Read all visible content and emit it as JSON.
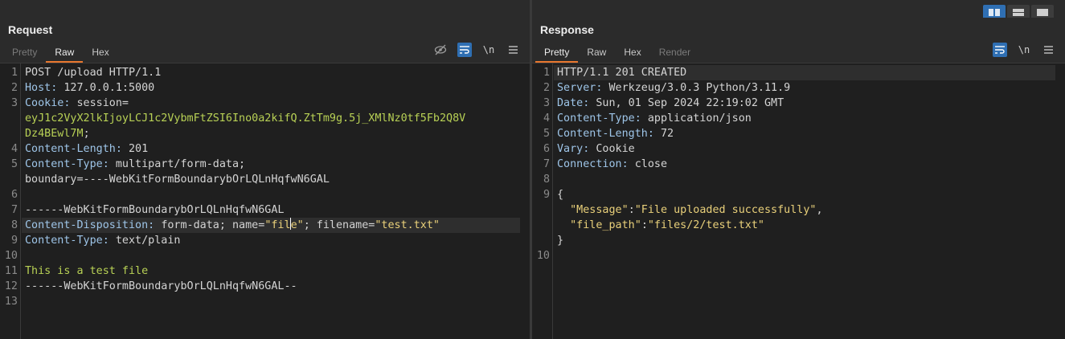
{
  "request": {
    "title": "Request",
    "tabs": [
      "Pretty",
      "Raw",
      "Hex"
    ],
    "active_tab": "Raw",
    "newline_label": "\\n",
    "lines": [
      {
        "n": "1",
        "parts": [
          [
            "w",
            "POST /upload HTTP/1.1"
          ]
        ]
      },
      {
        "n": "2",
        "parts": [
          [
            "k",
            "Host: "
          ],
          [
            "v",
            "127.0.0.1:5000"
          ]
        ]
      },
      {
        "n": "3",
        "parts": [
          [
            "k",
            "Cookie: "
          ],
          [
            "v",
            "session="
          ]
        ]
      },
      {
        "n": "",
        "parts": [
          [
            "g",
            "eyJ1c2VyX2lkIjoyLCJ1c2VybmFtZSI6Ino0a2kifQ.ZtTm9g.5j_XMlNz0tf5Fb2Q8V"
          ]
        ]
      },
      {
        "n": "",
        "parts": [
          [
            "g",
            "Dz4BEwl7M"
          ],
          [
            "v",
            ";"
          ]
        ]
      },
      {
        "n": "4",
        "parts": [
          [
            "k",
            "Content-Length: "
          ],
          [
            "v",
            "201"
          ]
        ]
      },
      {
        "n": "5",
        "parts": [
          [
            "k",
            "Content-Type: "
          ],
          [
            "v",
            "multipart/form-data;"
          ]
        ]
      },
      {
        "n": "",
        "parts": [
          [
            "v",
            "boundary=----WebKitFormBoundarybOrLQLnHqfwN6GAL"
          ]
        ]
      },
      {
        "n": "6",
        "parts": []
      },
      {
        "n": "7",
        "parts": [
          [
            "w",
            "------WebKitFormBoundarybOrLQLnHqfwN6GAL"
          ]
        ]
      },
      {
        "n": "8",
        "parts": [
          [
            "k",
            "Content-Disposition: "
          ],
          [
            "v",
            "form-data; name="
          ],
          [
            "y",
            "\"fil"
          ],
          [
            "cursor",
            ""
          ],
          [
            "y",
            "e\""
          ],
          [
            "v",
            "; filename="
          ],
          [
            "y",
            "\"test.txt\""
          ]
        ],
        "highlight": true
      },
      {
        "n": "9",
        "parts": [
          [
            "k",
            "Content-Type: "
          ],
          [
            "v",
            "text/plain"
          ]
        ]
      },
      {
        "n": "10",
        "parts": []
      },
      {
        "n": "11",
        "parts": [
          [
            "g",
            "This is a test file"
          ]
        ]
      },
      {
        "n": "12",
        "parts": [
          [
            "w",
            "------WebKitFormBoundarybOrLQLnHqfwN6GAL--"
          ]
        ]
      },
      {
        "n": "13",
        "parts": []
      }
    ]
  },
  "response": {
    "title": "Response",
    "tabs": [
      "Pretty",
      "Raw",
      "Hex",
      "Render"
    ],
    "active_tab": "Pretty",
    "newline_label": "\\n",
    "lines": [
      {
        "n": "1",
        "parts": [
          [
            "w",
            "HTTP/1.1 201 CREATED"
          ]
        ],
        "highlight": true
      },
      {
        "n": "2",
        "parts": [
          [
            "k",
            "Server: "
          ],
          [
            "v",
            "Werkzeug/3.0.3 Python/3.11.9"
          ]
        ]
      },
      {
        "n": "3",
        "parts": [
          [
            "k",
            "Date: "
          ],
          [
            "v",
            "Sun, 01 Sep 2024 22:19:02 GMT"
          ]
        ]
      },
      {
        "n": "4",
        "parts": [
          [
            "k",
            "Content-Type: "
          ],
          [
            "v",
            "application/json"
          ]
        ]
      },
      {
        "n": "5",
        "parts": [
          [
            "k",
            "Content-Length: "
          ],
          [
            "v",
            "72"
          ]
        ]
      },
      {
        "n": "6",
        "parts": [
          [
            "k",
            "Vary: "
          ],
          [
            "v",
            "Cookie"
          ]
        ]
      },
      {
        "n": "7",
        "parts": [
          [
            "k",
            "Connection: "
          ],
          [
            "v",
            "close"
          ]
        ]
      },
      {
        "n": "8",
        "parts": []
      },
      {
        "n": "9",
        "parts": [
          [
            "w",
            "{"
          ]
        ]
      },
      {
        "n": "",
        "parts": [
          [
            "w",
            "  "
          ],
          [
            "y",
            "\"Message\""
          ],
          [
            "w",
            ":"
          ],
          [
            "y",
            "\"File uploaded successfully\""
          ],
          [
            "w",
            ","
          ]
        ]
      },
      {
        "n": "",
        "parts": [
          [
            "w",
            "  "
          ],
          [
            "y",
            "\"file_path\""
          ],
          [
            "w",
            ":"
          ],
          [
            "y",
            "\"files/2/test.txt\""
          ]
        ]
      },
      {
        "n": "",
        "parts": [
          [
            "w",
            "}"
          ]
        ]
      },
      {
        "n": "10",
        "parts": []
      }
    ]
  }
}
